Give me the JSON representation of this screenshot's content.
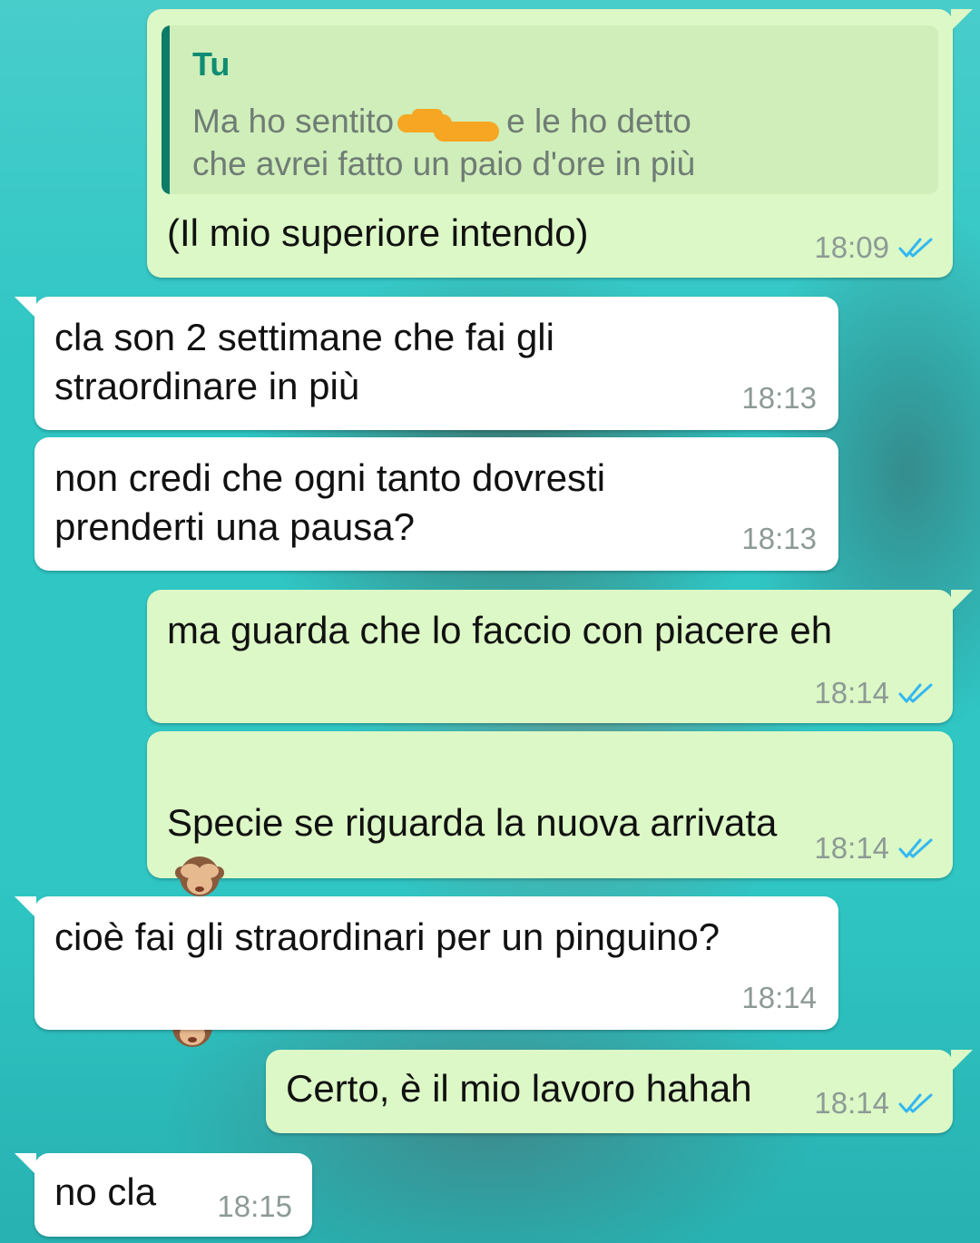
{
  "colors": {
    "outgoing_bubble": "#dcf8c6",
    "incoming_bubble": "#ffffff",
    "read_tick": "#34b7f1",
    "quote_author": "#0f8c73",
    "redaction": "#f6a623"
  },
  "messages": [
    {
      "direction": "outgoing",
      "quote": {
        "author": "Tu",
        "text_before_redaction": "Ma ho sentito",
        "text_after_redaction": "e le ho detto",
        "text_line2": "che avrei fatto un paio d'ore in più"
      },
      "text": "(Il mio superiore intendo)",
      "time": "18:09",
      "status": "read"
    },
    {
      "direction": "incoming",
      "text": "cla son 2 settimane che fai gli\nstraordinare in più",
      "time": "18:13"
    },
    {
      "direction": "incoming",
      "text": "non credi che ogni tanto dovresti\nprenderti una pausa?",
      "time": "18:13"
    },
    {
      "direction": "outgoing",
      "text": "ma guarda che lo faccio con piacere eh",
      "time": "18:14",
      "status": "read"
    },
    {
      "direction": "outgoing",
      "text": "Specie se riguarda la nuova arrivata",
      "emoji": "see-no-evil-monkey-icon",
      "time": "18:14",
      "status": "read"
    },
    {
      "direction": "incoming",
      "text": "cioè fai gli straordinari per un pinguino?",
      "time": "18:14"
    },
    {
      "direction": "outgoing",
      "text": "Certo, è il mio lavoro hahah",
      "time": "18:14",
      "status": "read"
    },
    {
      "direction": "incoming",
      "text": "no cla",
      "time": "18:15"
    }
  ]
}
